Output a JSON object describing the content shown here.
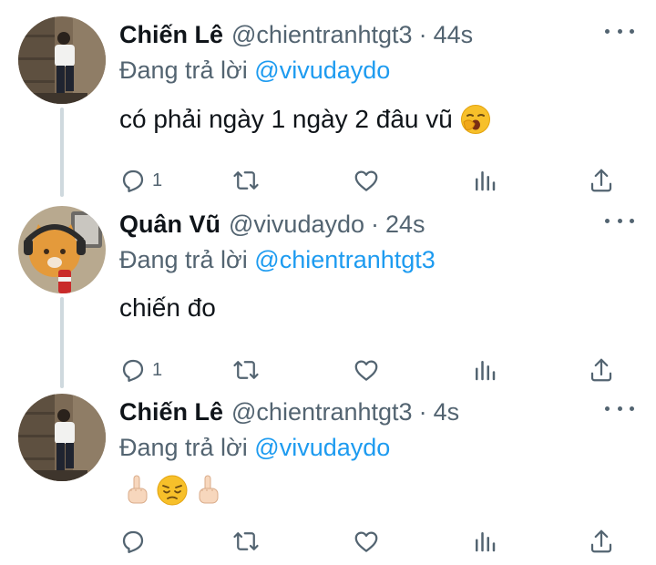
{
  "colors": {
    "accent": "#1d9bf0",
    "muted": "#536471",
    "text": "#0f1419",
    "thread_line": "#cfd9de"
  },
  "replying_prefix": "Đang trả lời",
  "tweets": [
    {
      "name": "Chiến Lê",
      "handle": "@chientranhtgt3",
      "separator": "·",
      "time": "44s",
      "reply_to": "@vivudaydo",
      "text": "có phải ngày 1 ngày 2 đâu vũ",
      "emoji": [
        "yawning-face"
      ],
      "reply_count": "1"
    },
    {
      "name": "Quân Vũ",
      "handle": "@vivudaydo",
      "separator": "·",
      "time": "24s",
      "reply_to": "@chientranhtgt3",
      "text": "chiến đo",
      "emoji": [],
      "reply_count": "1"
    },
    {
      "name": "Chiến Lê",
      "handle": "@chientranhtgt3",
      "separator": "·",
      "time": "4s",
      "reply_to": "@vivudaydo",
      "text": "",
      "emoji": [
        "middle-finger",
        "pensive-face",
        "middle-finger"
      ],
      "reply_count": ""
    }
  ],
  "icons": [
    "reply-icon",
    "retweet-icon",
    "like-icon",
    "analytics-icon",
    "share-icon",
    "more-icon"
  ]
}
